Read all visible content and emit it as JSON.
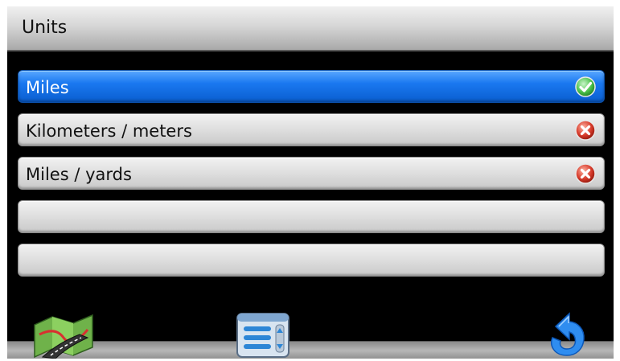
{
  "header": {
    "title": "Units"
  },
  "units_list": [
    {
      "label": "Miles",
      "selected": true,
      "status_icon": "check-icon"
    },
    {
      "label": "Kilometers / meters",
      "selected": false,
      "status_icon": "x-icon"
    },
    {
      "label": "Miles / yards",
      "selected": false,
      "status_icon": "x-icon"
    },
    {
      "label": "",
      "selected": false,
      "status_icon": ""
    },
    {
      "label": "",
      "selected": false,
      "status_icon": ""
    }
  ],
  "toolbar": {
    "left_icon": "map-icon",
    "center_icon": "menu-list-icon",
    "right_icon": "back-arrow-icon"
  },
  "colors": {
    "selected_row": "#1a78f0",
    "row": "#d9d9d9",
    "background": "#000000",
    "check": "#3bb54a",
    "cross": "#d63a2a"
  }
}
